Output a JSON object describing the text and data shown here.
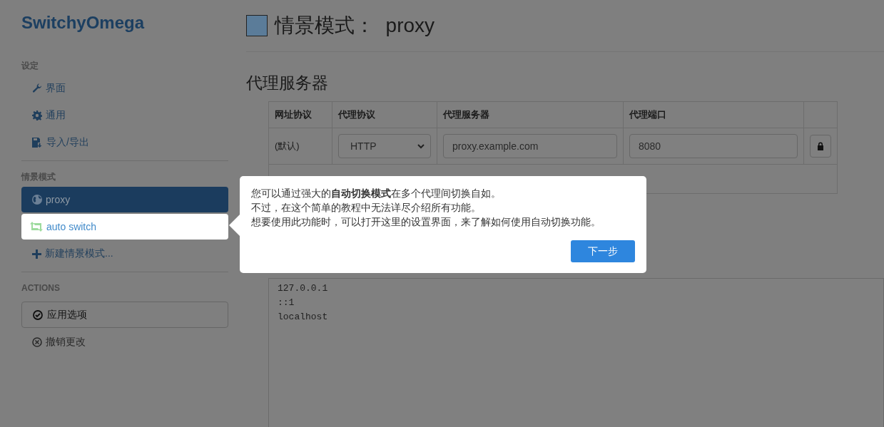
{
  "app": {
    "title": "SwitchyOmega"
  },
  "sidebar": {
    "sections": [
      {
        "heading": "设定",
        "items": [
          {
            "label": "界面",
            "selected": false,
            "highlighted": false
          },
          {
            "label": "通用",
            "selected": false,
            "highlighted": false
          },
          {
            "label": "导入/导出",
            "selected": false,
            "highlighted": false
          }
        ]
      },
      {
        "heading": "情景模式",
        "items": [
          {
            "label": "proxy",
            "selected": true,
            "highlighted": false
          },
          {
            "label": "auto switch",
            "selected": false,
            "highlighted": true
          },
          {
            "label": "新建情景模式...",
            "selected": false,
            "highlighted": false
          }
        ]
      },
      {
        "heading": "ACTIONS",
        "items": [
          {
            "label": "应用选项",
            "kind": "button"
          },
          {
            "label": "撤销更改",
            "kind": "link"
          }
        ]
      }
    ]
  },
  "main": {
    "header": {
      "label": "情景模式：",
      "name": "proxy"
    },
    "section_title": "代理服务器",
    "table": {
      "columns": [
        "网址协议",
        "代理协议",
        "代理服务器",
        "代理端口"
      ],
      "rows": [
        {
          "scheme": "(默认)",
          "protocol": "HTTP",
          "server": "proxy.example.com",
          "port": "8080"
        }
      ]
    },
    "bypass_list": [
      "127.0.0.1",
      "::1",
      "localhost"
    ]
  },
  "popover": {
    "lines": [
      "您可以通过强大的**自动切换模式**在多个代理间切换自如。",
      "不过，在这个简单的教程中无法详尽介绍所有功能。",
      "想要使用此功能时，可以打开这里的设置界面，来了解如何使用自动切换功能。"
    ],
    "button": "下一步"
  }
}
